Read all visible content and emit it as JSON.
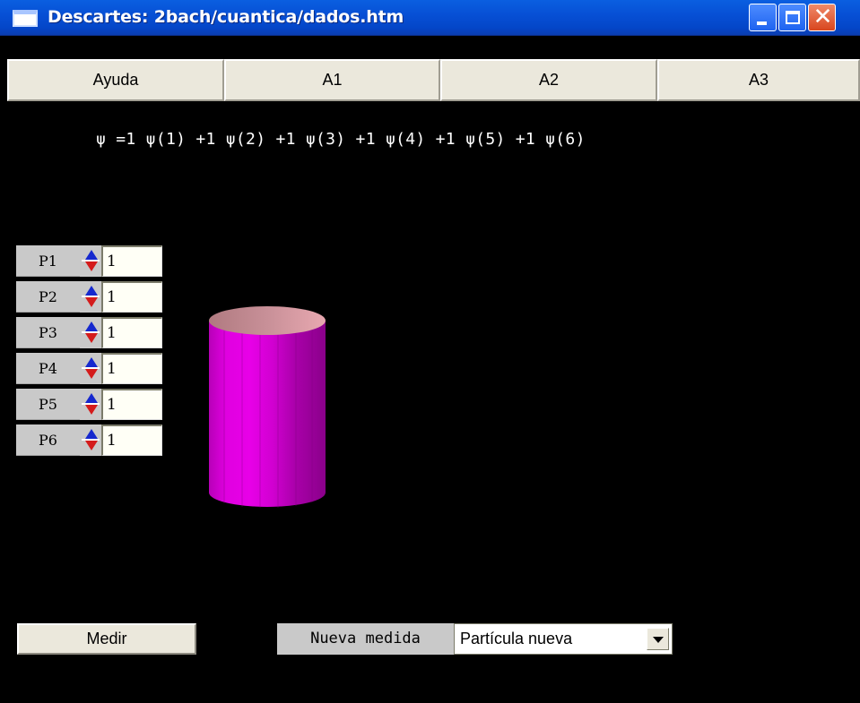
{
  "window": {
    "title": "Descartes: 2bach/cuantica/dados.htm"
  },
  "menu": {
    "tabs": [
      "Ayuda",
      "A1",
      "A2",
      "A3"
    ]
  },
  "formula": "ψ =1 ψ(1) +1 ψ(2) +1 ψ(3) +1 ψ(4) +1 ψ(5) +1 ψ(6)",
  "params": [
    {
      "label": "P1",
      "value": "1"
    },
    {
      "label": "P2",
      "value": "1"
    },
    {
      "label": "P3",
      "value": "1"
    },
    {
      "label": "P4",
      "value": "1"
    },
    {
      "label": "P5",
      "value": "1"
    },
    {
      "label": "P6",
      "value": "1"
    }
  ],
  "controls": {
    "medir_label": "Medir",
    "nueva_medida_label": "Nueva medida",
    "nueva_medida_selected": "Partícula nueva"
  },
  "colors": {
    "cylinder": "#dd00dd",
    "cylinder_top": "#d4a3a8",
    "background": "#000000"
  },
  "icons": [
    "window-app-icon",
    "minimize-icon",
    "maximize-icon",
    "close-icon",
    "spinner-up-icon",
    "spinner-down-icon",
    "dropdown-arrow-icon"
  ]
}
